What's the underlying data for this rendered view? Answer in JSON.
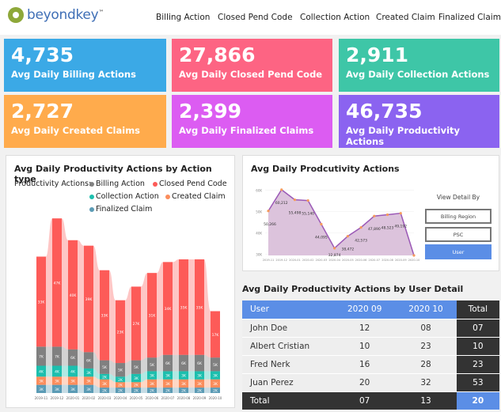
{
  "header": {
    "logo": "beyondkey",
    "logo_tm": "™",
    "nav": [
      "Billing Action",
      "Closed Pend Code",
      "Collection Action",
      "Created Claim",
      "Finalized Claim"
    ]
  },
  "kpis": [
    {
      "value": "4,735",
      "label": "Avg Daily Billing Actions",
      "color": "#3ba9e6"
    },
    {
      "value": "27,866",
      "label": "Avg Daily Closed Pend Code",
      "color": "#fd6483"
    },
    {
      "value": "2,911",
      "label": "Avg Daily Collection Actions",
      "color": "#3ec6a7"
    },
    {
      "value": "2,727",
      "label": "Avg Daily Created Claims",
      "color": "#ffab4c"
    },
    {
      "value": "2,399",
      "label": "Avg Daily Finalized Claims",
      "color": "#dc5cf2"
    },
    {
      "value": "46,735",
      "label": "Avg Daily Productivity Actions",
      "color": "#8b63f0"
    }
  ],
  "ribbon": {
    "title": "Avg Daily Productivity Actions by Action type",
    "legend_title": "Productivity Actions:",
    "chart_data": {
      "type": "bar",
      "stacked": true,
      "categories": [
        "2019-11",
        "2019-12",
        "2020-01",
        "2020-02",
        "2020-03",
        "2020-04",
        "2020-05",
        "2020-06",
        "2020-07",
        "2020-08",
        "2020-09",
        "2020-10"
      ],
      "series": [
        {
          "name": "Finalized Claim",
          "color": "#5b9bb5",
          "values": [
            3,
            3,
            3,
            3,
            2,
            2,
            2,
            2,
            2,
            2,
            2,
            2
          ]
        },
        {
          "name": "Created Claim",
          "color": "#fb8d5c",
          "values": [
            3,
            3,
            3,
            3,
            3,
            2,
            2,
            3,
            3,
            3,
            3,
            3
          ]
        },
        {
          "name": "Collection Action",
          "color": "#1cbfae",
          "values": [
            4,
            4,
            4,
            3,
            2,
            2,
            3,
            3,
            3,
            3,
            3,
            3
          ]
        },
        {
          "name": "Billing Action",
          "color": "#808080",
          "values": [
            7,
            7,
            6,
            6,
            5,
            5,
            5,
            5,
            6,
            6,
            6,
            5
          ]
        },
        {
          "name": "Closed Pend Code",
          "color": "#fd5b58",
          "values": [
            33,
            47,
            40,
            39,
            33,
            23,
            27,
            31,
            34,
            35,
            35,
            17
          ]
        }
      ],
      "unit": "K"
    }
  },
  "line": {
    "title": "Avg Daily Prodcutivity Actions",
    "chart_data": {
      "type": "area",
      "x": [
        "2019-11",
        "2019-12",
        "2020-01",
        "2020-02",
        "2020-03",
        "2020-04",
        "2020-05",
        "2020-06",
        "2020-07",
        "2020-08",
        "2020-09",
        "2020-10"
      ],
      "y": [
        50266,
        60212,
        55498,
        55140,
        44095,
        32874,
        38472,
        42573,
        47890,
        48523,
        49192,
        29500
      ],
      "labels": [
        "50,266",
        "60,212",
        "55,498",
        "55,140",
        "44,095",
        "32,874",
        "38,472",
        "42,573",
        "47,890",
        "48,523",
        "49,192",
        ""
      ],
      "yticks": [
        "60K",
        "50K",
        "40K",
        "30K"
      ],
      "ylim": [
        29500,
        62000
      ],
      "line_color": "#9b59b6",
      "fill_color": "#dcc3dc",
      "marker_color": "#f59a5b"
    },
    "view_detail": {
      "title": "View Detail By",
      "options": [
        "Billing Region",
        "PSC",
        "User"
      ],
      "selected": "User"
    }
  },
  "table": {
    "title": "Avg Daily Productivity Actions by User Detail",
    "columns": [
      "User",
      "2020  09",
      "2020  10",
      "Total"
    ],
    "rows": [
      [
        "John Doe",
        "12",
        "08",
        "07"
      ],
      [
        "Albert Cristian",
        "10",
        "23",
        "10"
      ],
      [
        "Fred Nerk",
        "16",
        "28",
        "23"
      ],
      [
        "Juan Perez",
        "20",
        "32",
        "53"
      ]
    ],
    "total": [
      "Total",
      "07",
      "13",
      "20"
    ]
  }
}
